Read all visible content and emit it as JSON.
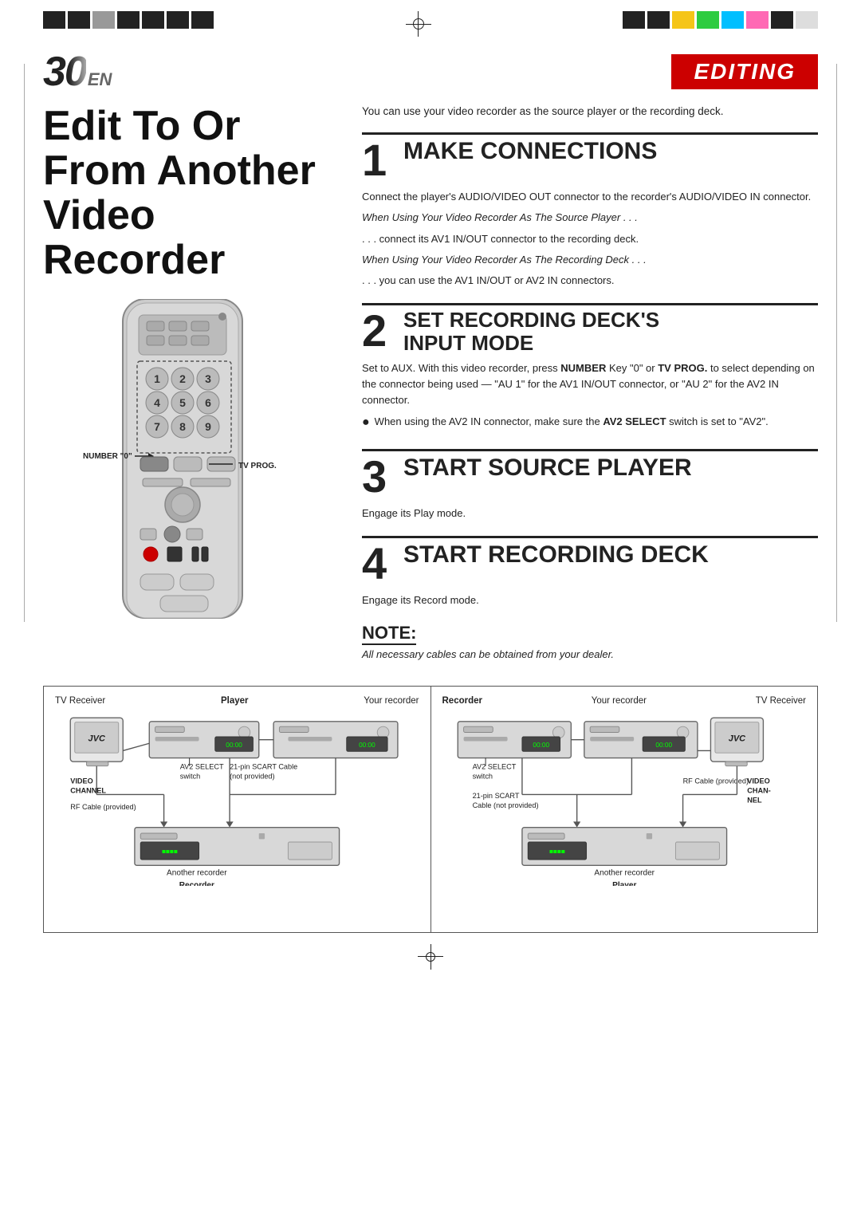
{
  "page": {
    "number": "30",
    "number_suffix": "EN",
    "section_badge": "EDITING",
    "title": "Edit To Or From Another Video Recorder",
    "intro_text": "You can use your video recorder as the source player or the recording deck.",
    "steps": [
      {
        "number": "1",
        "title": "Make Connections",
        "body": [
          "Connect the player's AUDIO/VIDEO OUT connector to the recorder's AUDIO/VIDEO IN connector.",
          "When Using Your Video Recorder As The Source Player . . .",
          ". . . connect its AV1 IN/OUT connector to the recording deck.",
          "When Using Your Video Recorder As The Recording Deck . . .",
          ". . . you can use the AV1 IN/OUT or AV2 IN connectors."
        ],
        "italic_indices": [
          1,
          3
        ],
        "bold_parts": []
      },
      {
        "number": "2",
        "title": "Set Recording Deck's Input Mode",
        "body": [
          "Set to AUX. With this video recorder, press NUMBER Key \"0\" or TV PROG. to select depending on the connector being used — \"AU 1\" for the AV1 IN/OUT connector, or \"AU 2\" for the AV2 IN connector.",
          "When using the AV2 IN connector, make sure the AV2 SELECT switch is set to \"AV2\"."
        ],
        "has_bullet": [
          false,
          true
        ]
      },
      {
        "number": "3",
        "title": "Start Source Player",
        "body": [
          "Engage its Play mode."
        ]
      },
      {
        "number": "4",
        "title": "Start Recording Deck",
        "body": [
          "Engage its Record mode."
        ]
      }
    ],
    "note": {
      "title": "NOTE:",
      "text": "All necessary cables can be obtained from your dealer."
    },
    "remote_labels": {
      "number0": "NUMBER \"0\"",
      "tvprog": "TV PROG."
    },
    "diagram": {
      "left": {
        "label_left": "TV Receiver",
        "label_player": "Player",
        "label_your_recorder": "Your recorder",
        "label_av2": "AV2 SELECT",
        "label_av2b": "switch",
        "label_video": "VIDEO",
        "label_channel": "CHANNEL",
        "label_rf": "RF Cable (provided)",
        "label_21pin": "21-pin SCART Cable",
        "label_21pin_b": "(not provided)",
        "label_another": "Another recorder",
        "label_recorder": "Recorder"
      },
      "right": {
        "label_recorder": "Recorder",
        "label_your_recorder": "Your recorder",
        "label_tv": "TV Receiver",
        "label_av2": "AV2 SELECT",
        "label_av2b": "switch",
        "label_21pin": "21-pin SCART",
        "label_21pin_b": "Cable (not provided)",
        "label_rf": "RF Cable (provided)",
        "label_video": "VIDEO CHAN-",
        "label_nel": "NEL",
        "label_another": "Another recorder",
        "label_player": "Player"
      }
    },
    "colors": {
      "accent_red": "#cc0000",
      "text_dark": "#111111",
      "border": "#555555"
    }
  }
}
